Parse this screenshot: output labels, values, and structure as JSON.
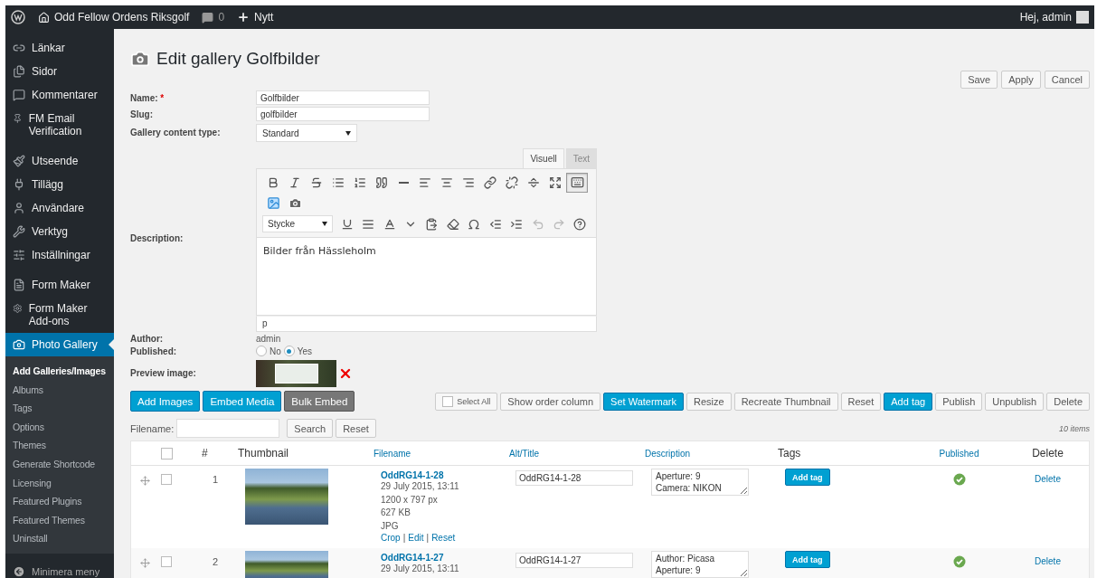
{
  "admin_bar": {
    "site_name": "Odd Fellow Ordens Riksgolf",
    "comments_count": "0",
    "new_label": "Nytt",
    "greeting": "Hej, admin"
  },
  "sidebar": {
    "groups": [
      [
        {
          "label": "Länkar",
          "selected": false
        },
        {
          "label": "Sidor",
          "selected": false
        },
        {
          "label": "Kommentarer",
          "selected": false
        },
        {
          "label": "FM Email Verification",
          "selected": false
        }
      ],
      [
        {
          "label": "Utseende",
          "selected": false
        },
        {
          "label": "Tillägg",
          "selected": false
        },
        {
          "label": "Användare",
          "selected": false
        },
        {
          "label": "Verktyg",
          "selected": false
        },
        {
          "label": "Inställningar",
          "selected": false
        }
      ],
      [
        {
          "label": "Form Maker",
          "selected": false
        },
        {
          "label": "Form Maker Add-ons",
          "selected": false
        },
        {
          "label": "Photo Gallery",
          "selected": true,
          "children": [
            {
              "label": "Add Galleries/Images",
              "selected": true
            },
            {
              "label": "Albums",
              "selected": false
            },
            {
              "label": "Tags",
              "selected": false
            },
            {
              "label": "Options",
              "selected": false
            },
            {
              "label": "Themes",
              "selected": false
            },
            {
              "label": "Generate Shortcode",
              "selected": false
            },
            {
              "label": "Licensing",
              "selected": false
            },
            {
              "label": "Featured Plugins",
              "selected": false
            },
            {
              "label": "Featured Themes",
              "selected": false
            },
            {
              "label": "Uninstall",
              "selected": false
            }
          ]
        }
      ]
    ],
    "collapse_label": "Minimera meny"
  },
  "page": {
    "title": "Edit gallery Golfbilder",
    "actions": [
      "Save",
      "Apply",
      "Cancel"
    ]
  },
  "form": {
    "name_label": "Name:",
    "required_mark": "*",
    "name_value": "Golfbilder",
    "slug_label": "Slug:",
    "slug_value": "golfbilder",
    "type_label": "Gallery content type:",
    "type_value": "Standard",
    "description_label": "Description:",
    "author_label": "Author:",
    "author_value": "admin",
    "published_label": "Published:",
    "published_options": [
      {
        "label": "No",
        "selected": false
      },
      {
        "label": "Yes",
        "selected": true
      }
    ],
    "preview_label": "Preview image:"
  },
  "editor": {
    "tabs": [
      {
        "label": "Visuell",
        "selected": true
      },
      {
        "label": "Text",
        "selected": false
      }
    ],
    "toolbar_toggle_on": true,
    "format_value": "Stycke",
    "content": "Bilder från Hässleholm",
    "path": "p"
  },
  "media_buttons": [
    {
      "label": "Add Images",
      "kind": "primary"
    },
    {
      "label": "Embed Media",
      "kind": "primary"
    },
    {
      "label": "Bulk Embed",
      "kind": "dark"
    }
  ],
  "bulk_actions": [
    {
      "label": "Select All",
      "kind": "checkbox",
      "checked": false
    },
    {
      "label": "Show order column",
      "kind": "default"
    },
    {
      "label": "Set Watermark",
      "kind": "primary"
    },
    {
      "label": "Resize",
      "kind": "default"
    },
    {
      "label": "Recreate Thumbnail",
      "kind": "default"
    },
    {
      "label": "Reset",
      "kind": "default"
    },
    {
      "label": "Add tag",
      "kind": "primary"
    },
    {
      "label": "Publish",
      "kind": "default"
    },
    {
      "label": "Unpublish",
      "kind": "default"
    },
    {
      "label": "Delete",
      "kind": "default"
    }
  ],
  "filter": {
    "label": "Filename:",
    "search": "Search",
    "reset": "Reset",
    "count": "10 items"
  },
  "table": {
    "select_all_checked": false,
    "columns": [
      {
        "label": "#",
        "kind": "plain"
      },
      {
        "label": "Thumbnail",
        "kind": "plain"
      },
      {
        "label": "Filename",
        "kind": "sort"
      },
      {
        "label": "Alt/Title",
        "kind": "sort"
      },
      {
        "label": "Description",
        "kind": "sort"
      },
      {
        "label": "Tags",
        "kind": "plain"
      },
      {
        "label": "Published",
        "kind": "sort"
      },
      {
        "label": "Delete",
        "kind": "plain"
      }
    ],
    "link_separator": "|",
    "rows": [
      {
        "number": "1",
        "checked": false,
        "filename": "OddRG14-1-28",
        "meta": [
          "29 July 2015, 13:11",
          "1200 x 797 px",
          "627 KB",
          "JPG"
        ],
        "links": [
          "Crop",
          "Edit",
          "Reset"
        ],
        "alt": "OddRG14-1-28",
        "description": "Aperture: 9\nCamera: NIKON",
        "tag_button": "Add tag",
        "published": true,
        "delete": "Delete"
      },
      {
        "number": "2",
        "checked": false,
        "filename": "OddRG14-1-27",
        "meta": [
          "29 July 2015, 13:11"
        ],
        "alt": "OddRG14-1-27",
        "description": "Author: Picasa\nAperture: 9",
        "tag_button": "Add tag",
        "published": true,
        "delete": "Delete"
      }
    ]
  }
}
